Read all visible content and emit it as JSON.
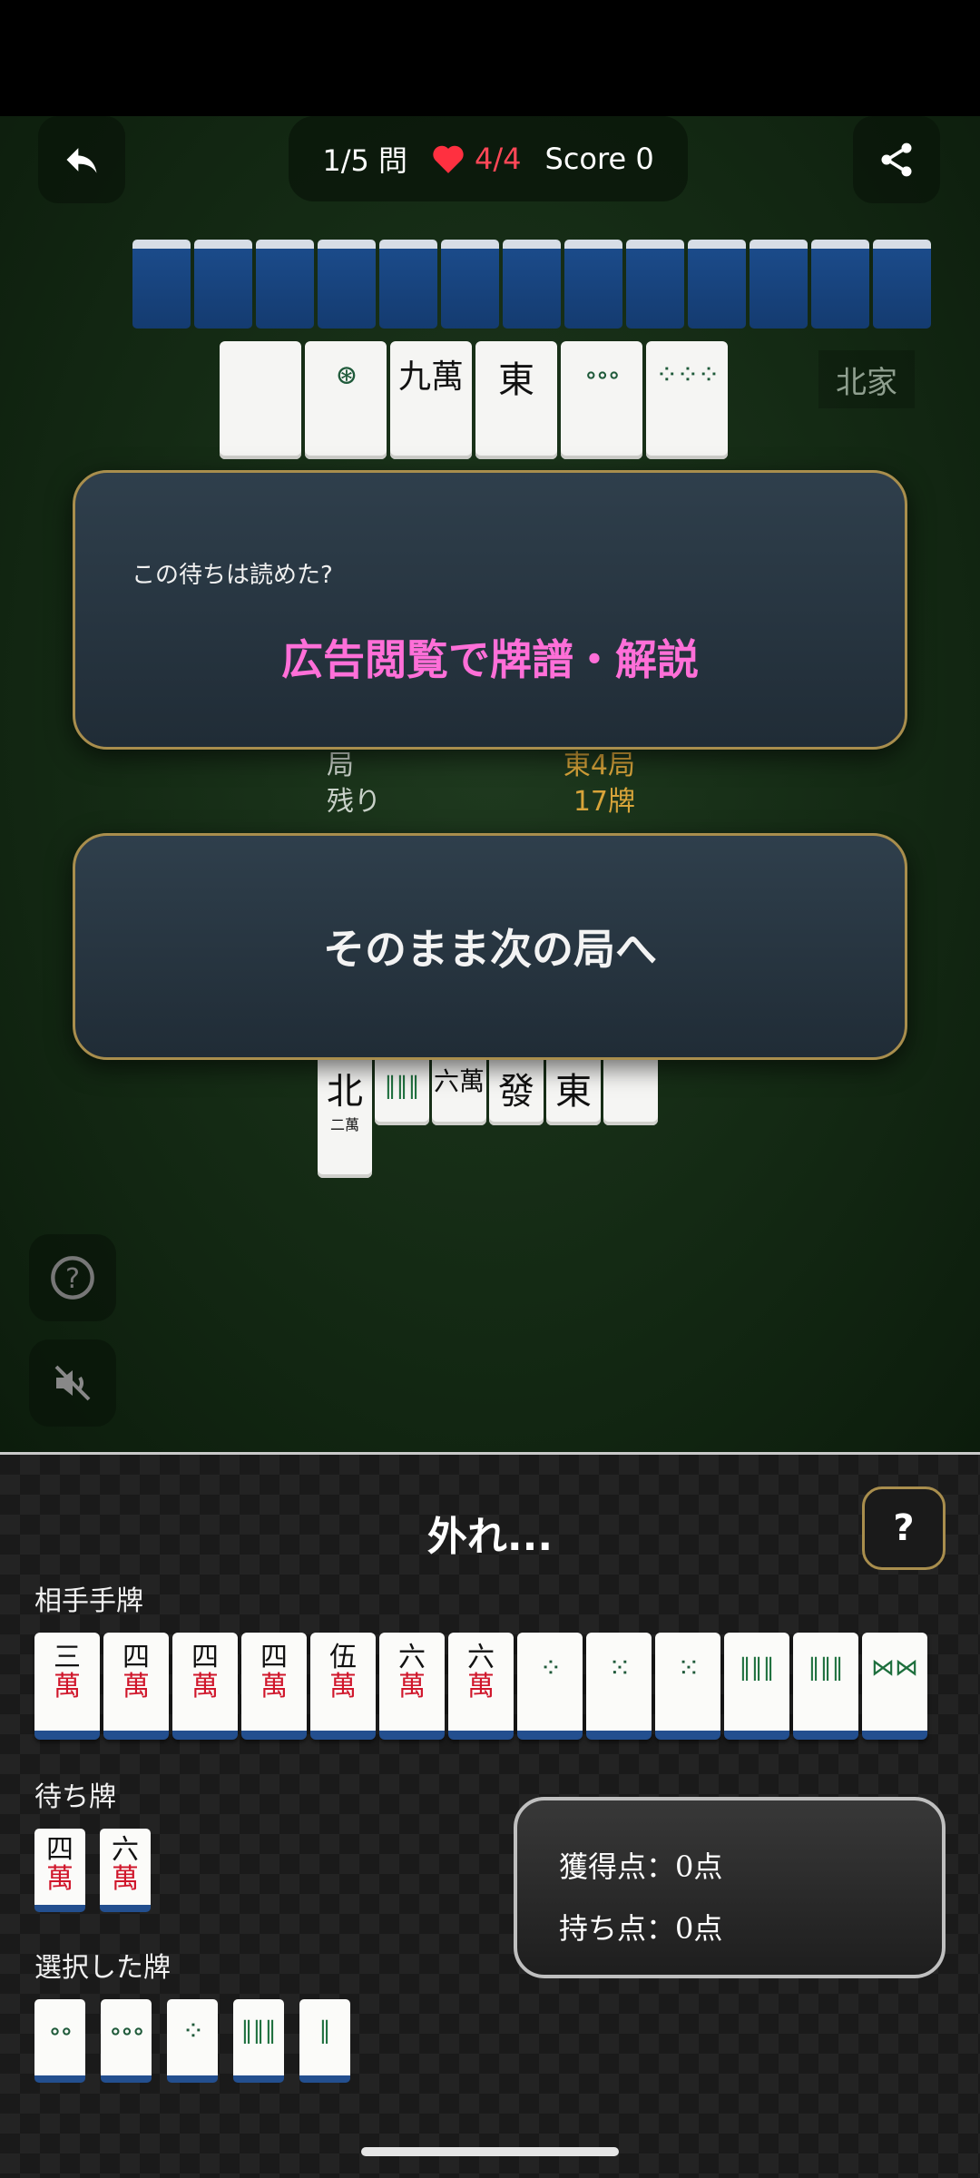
{
  "hud": {
    "question": "1/5 問",
    "lives": "4/4",
    "score": "Score 0"
  },
  "table": {
    "seat_label": "北家",
    "info": [
      {
        "label": "局",
        "value": "東4局"
      },
      {
        "label": "残り",
        "value": "17牌"
      }
    ],
    "north_discards": [
      {
        "kind": "blank"
      },
      {
        "kind": "pin",
        "glyph": "⊛"
      },
      {
        "kind": "man",
        "num": "九",
        "suit": "萬"
      },
      {
        "kind": "honor",
        "glyph": "東"
      },
      {
        "kind": "pin",
        "glyph": "∘∘∘"
      },
      {
        "kind": "pin",
        "glyph": "⁘⁘⁘"
      }
    ],
    "south_discards": [
      {
        "kind": "honor",
        "glyph": "北"
      },
      {
        "kind": "sou",
        "glyph": "‖‖‖"
      },
      {
        "kind": "man",
        "num": "六",
        "suit": "萬"
      },
      {
        "kind": "honor",
        "glyph": "發"
      },
      {
        "kind": "honor",
        "glyph": "東"
      },
      {
        "kind": "blank"
      }
    ],
    "south_extra": {
      "kind": "man",
      "num": "二",
      "suit": "萬"
    }
  },
  "overlay": {
    "prompt": "この待ちは読めた?",
    "ad_link": "広告閲覧で牌譜・解説",
    "next_button": "そのまま次の局へ"
  },
  "panel": {
    "result": "外れ...",
    "help_label": "?",
    "hand_label": "相手手牌",
    "hand": [
      {
        "kind": "man",
        "num": "三",
        "suit": "萬"
      },
      {
        "kind": "man",
        "num": "四",
        "suit": "萬"
      },
      {
        "kind": "man",
        "num": "四",
        "suit": "萬"
      },
      {
        "kind": "man",
        "num": "四",
        "suit": "萬"
      },
      {
        "kind": "man",
        "num": "伍",
        "suit": "萬"
      },
      {
        "kind": "man",
        "num": "六",
        "suit": "萬"
      },
      {
        "kind": "man",
        "num": "六",
        "suit": "萬"
      },
      {
        "kind": "pin",
        "glyph": "⁘"
      },
      {
        "kind": "pin",
        "glyph": "⁙"
      },
      {
        "kind": "pin",
        "glyph": "⁙"
      },
      {
        "kind": "sou",
        "glyph": "‖‖‖"
      },
      {
        "kind": "sou",
        "glyph": "‖‖‖"
      },
      {
        "kind": "sou",
        "glyph": "⋈⋈"
      }
    ],
    "wait_label": "待ち牌",
    "waits": [
      {
        "kind": "man",
        "num": "四",
        "suit": "萬"
      },
      {
        "kind": "man",
        "num": "六",
        "suit": "萬"
      }
    ],
    "selected_label": "選択した牌",
    "selected": [
      {
        "kind": "pin",
        "glyph": "∘∘"
      },
      {
        "kind": "pin",
        "glyph": "∘∘∘"
      },
      {
        "kind": "pin",
        "glyph": "⁘"
      },
      {
        "kind": "sou",
        "glyph": "‖‖‖"
      },
      {
        "kind": "sou",
        "glyph": "‖"
      }
    ],
    "earned": "獲得点：0点",
    "held": "持ち点：0点"
  },
  "icons": {
    "back": "back-arrow-icon",
    "share": "share-icon",
    "heart": "heart-icon",
    "help": "question-circle-icon",
    "mute": "mute-icon"
  },
  "colors": {
    "accent_pink": "#ff6fd8",
    "heart_red": "#ff4757",
    "gold_border": "#a98e4d"
  }
}
